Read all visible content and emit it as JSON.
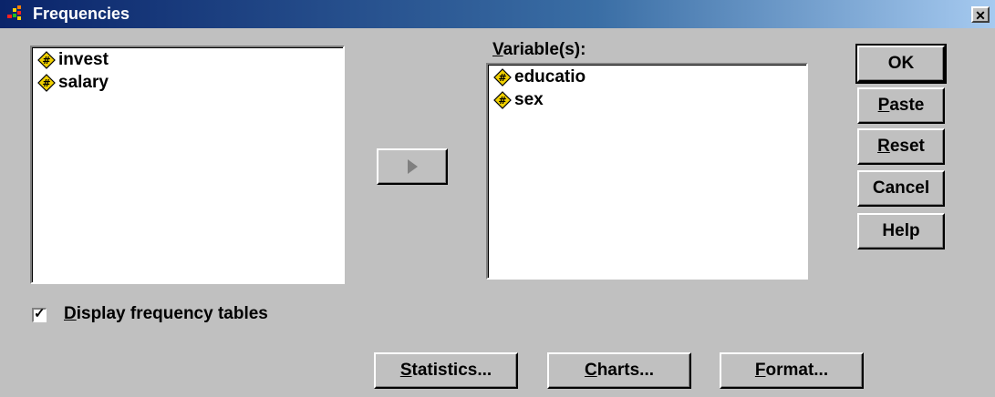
{
  "window": {
    "title": "Frequencies",
    "close_glyph": "✕"
  },
  "source_list": {
    "items": [
      {
        "label": "invest",
        "icon": "numeric-variable-icon"
      },
      {
        "label": "salary",
        "icon": "numeric-variable-icon"
      }
    ]
  },
  "variables": {
    "label_accel": "V",
    "label_rest": "ariable(s):",
    "items": [
      {
        "label": "educatio",
        "icon": "numeric-variable-icon"
      },
      {
        "label": "sex",
        "icon": "numeric-variable-icon"
      }
    ]
  },
  "buttons": {
    "ok": {
      "label": "OK"
    },
    "paste": {
      "accel": "P",
      "rest": "aste"
    },
    "reset": {
      "accel": "R",
      "rest": "eset"
    },
    "cancel": {
      "label": "Cancel"
    },
    "help": {
      "label": "Help"
    },
    "statistics": {
      "accel": "S",
      "rest": "tatistics..."
    },
    "charts": {
      "accel": "C",
      "rest": "harts..."
    },
    "format": {
      "accel": "F",
      "rest": "ormat..."
    }
  },
  "display_tables": {
    "checked": true,
    "accel": "D",
    "rest": "isplay frequency tables"
  },
  "colors": {
    "title_start": "#0a246a",
    "title_end": "#a6caf0",
    "face": "#c0c0c0",
    "icon_fill": "#f0d000"
  }
}
